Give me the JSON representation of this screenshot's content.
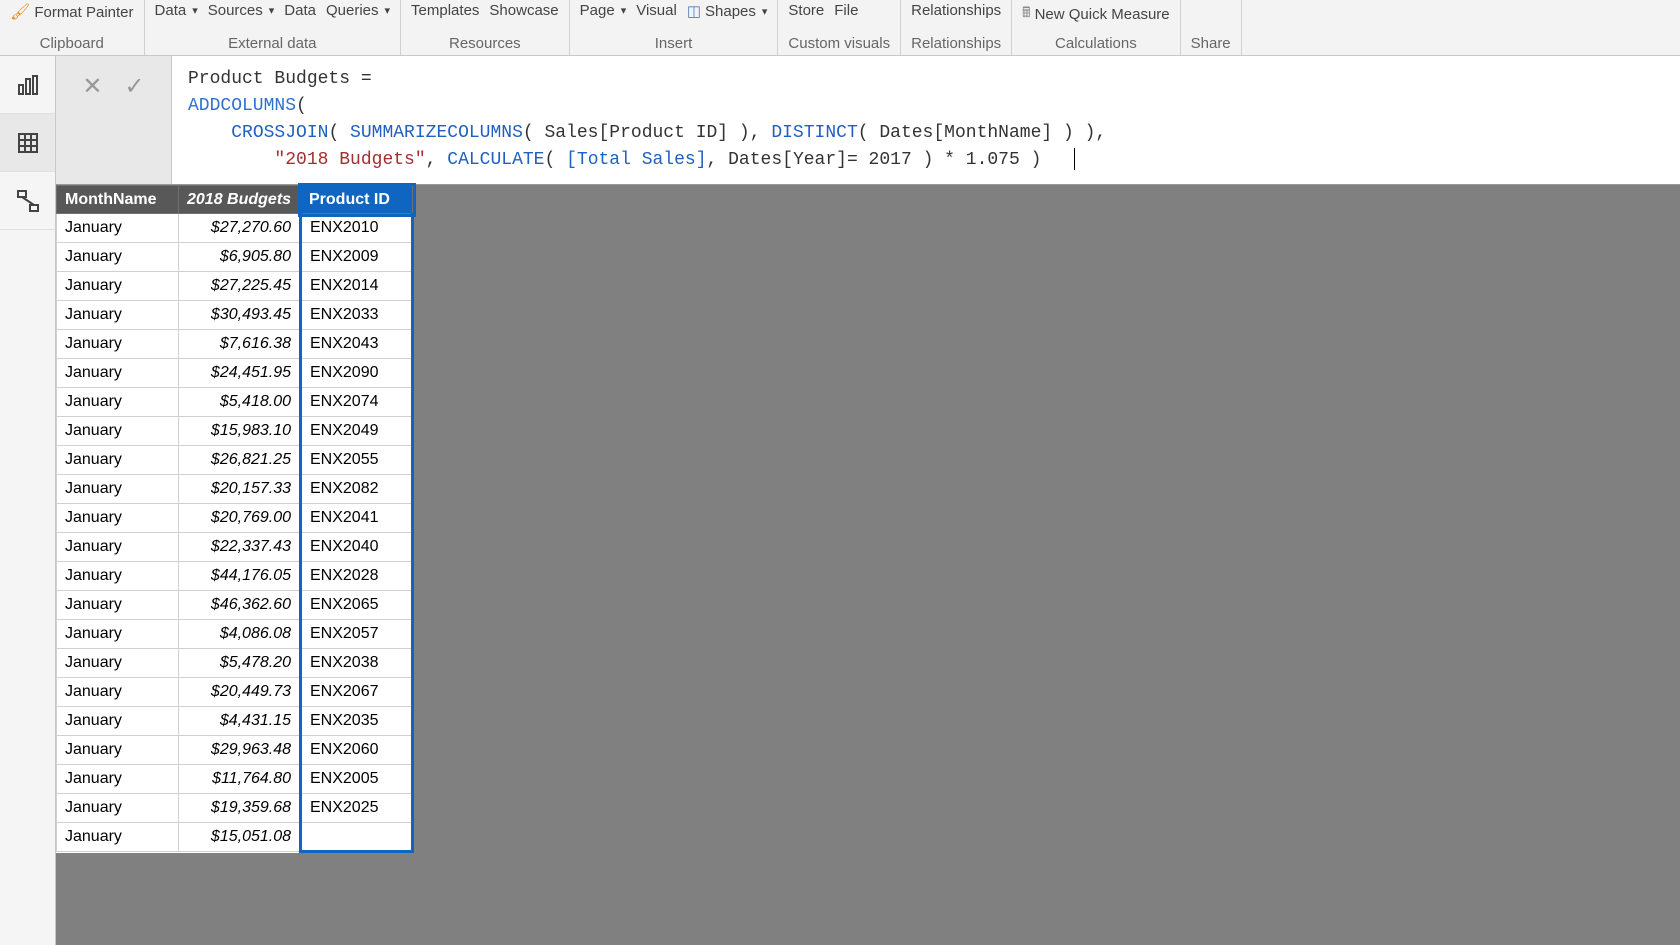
{
  "ribbon": {
    "groups": [
      {
        "label": "Clipboard",
        "buttons": [
          {
            "label": "Format Painter",
            "name": "format-painter-button",
            "icon": "brush"
          }
        ]
      },
      {
        "label": "External data",
        "buttons": [
          {
            "label": "Data",
            "name": "data-dropdown",
            "dropdown": true
          },
          {
            "label": "Sources",
            "name": "sources-dropdown",
            "dropdown": true
          },
          {
            "label": "Data",
            "name": "data-button-2"
          },
          {
            "label": "Queries",
            "name": "queries-dropdown",
            "dropdown": true
          }
        ]
      },
      {
        "label": "Resources",
        "buttons": [
          {
            "label": "Templates",
            "name": "templates-button"
          },
          {
            "label": "Showcase",
            "name": "showcase-button"
          }
        ]
      },
      {
        "label": "Insert",
        "buttons": [
          {
            "label": "Page",
            "name": "page-dropdown",
            "dropdown": true
          },
          {
            "label": "Visual",
            "name": "visual-button"
          },
          {
            "label": "Shapes",
            "name": "shapes-dropdown",
            "dropdown": true,
            "icon": "shapes"
          }
        ]
      },
      {
        "label": "Custom visuals",
        "buttons": [
          {
            "label": "Store",
            "name": "store-button"
          },
          {
            "label": "File",
            "name": "file-button"
          }
        ]
      },
      {
        "label": "Relationships",
        "buttons": [
          {
            "label": "Relationships",
            "name": "relationships-button"
          }
        ]
      },
      {
        "label": "Calculations",
        "buttons": [
          {
            "label": "New Quick Measure",
            "name": "new-quick-measure-button",
            "icon": "measure"
          }
        ]
      },
      {
        "label": "Share",
        "buttons": []
      }
    ]
  },
  "formula": {
    "line1_prefix": "Product Budgets = ",
    "line2_func": "ADDCOLUMNS",
    "line2_paren": "(",
    "line3_indent": "    ",
    "line3_func": "CROSSJOIN",
    "line3_open": "( ",
    "line3_func2": "SUMMARIZECOLUMNS",
    "line3_args": "( Sales[Product ID] ), ",
    "line3_func3": "DISTINCT",
    "line3_args2": "( Dates[MonthName] ) ),",
    "line4_indent": "        ",
    "line4_str": "\"2018 Budgets\"",
    "line4_comma": ", ",
    "line4_func": "CALCULATE",
    "line4_open": "( ",
    "line4_meas": "[Total Sales]",
    "line4_rest": ", Dates[Year]= 2017 ) * 1.075 )"
  },
  "table": {
    "headers": [
      "MonthName",
      "2018 Budgets",
      "Product ID"
    ],
    "selected_column_index": 2,
    "rows": [
      {
        "month": "January",
        "budget": "$27,270.60",
        "product": "ENX2010"
      },
      {
        "month": "January",
        "budget": "$6,905.80",
        "product": "ENX2009"
      },
      {
        "month": "January",
        "budget": "$27,225.45",
        "product": "ENX2014"
      },
      {
        "month": "January",
        "budget": "$30,493.45",
        "product": "ENX2033"
      },
      {
        "month": "January",
        "budget": "$7,616.38",
        "product": "ENX2043"
      },
      {
        "month": "January",
        "budget": "$24,451.95",
        "product": "ENX2090"
      },
      {
        "month": "January",
        "budget": "$5,418.00",
        "product": "ENX2074"
      },
      {
        "month": "January",
        "budget": "$15,983.10",
        "product": "ENX2049"
      },
      {
        "month": "January",
        "budget": "$26,821.25",
        "product": "ENX2055"
      },
      {
        "month": "January",
        "budget": "$20,157.33",
        "product": "ENX2082"
      },
      {
        "month": "January",
        "budget": "$20,769.00",
        "product": "ENX2041"
      },
      {
        "month": "January",
        "budget": "$22,337.43",
        "product": "ENX2040"
      },
      {
        "month": "January",
        "budget": "$44,176.05",
        "product": "ENX2028"
      },
      {
        "month": "January",
        "budget": "$46,362.60",
        "product": "ENX2065"
      },
      {
        "month": "January",
        "budget": "$4,086.08",
        "product": "ENX2057"
      },
      {
        "month": "January",
        "budget": "$5,478.20",
        "product": "ENX2038"
      },
      {
        "month": "January",
        "budget": "$20,449.73",
        "product": "ENX2067"
      },
      {
        "month": "January",
        "budget": "$4,431.15",
        "product": "ENX2035"
      },
      {
        "month": "January",
        "budget": "$29,963.48",
        "product": "ENX2060"
      },
      {
        "month": "January",
        "budget": "$11,764.80",
        "product": "ENX2005"
      },
      {
        "month": "January",
        "budget": "$19,359.68",
        "product": "ENX2025"
      },
      {
        "month": "January",
        "budget": "$15,051.08",
        "product": ""
      }
    ]
  }
}
